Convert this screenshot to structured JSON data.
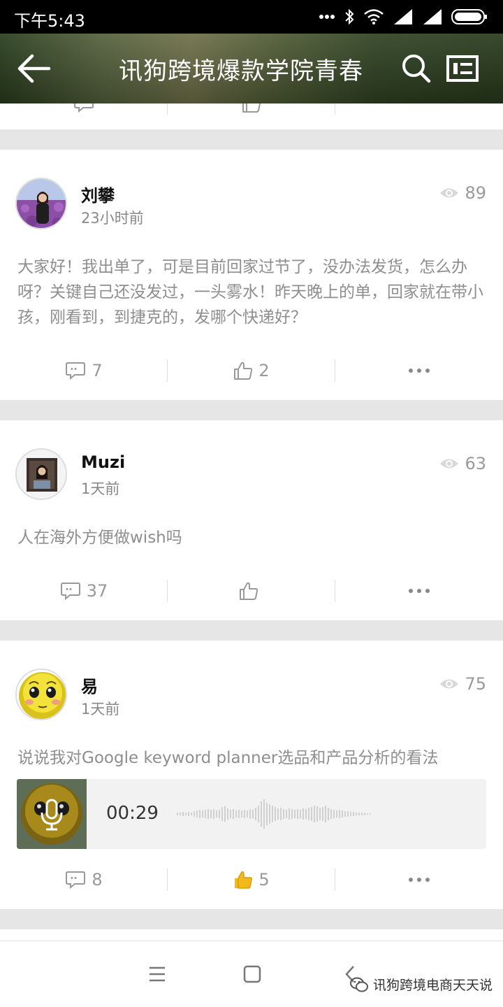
{
  "status_bar": {
    "time": "下午5:43"
  },
  "top_bar": {
    "title": "讯狗跨境爆款学院青春",
    "back_icon": "arrow-left-icon",
    "search_icon": "search-icon",
    "profile_icon": "profile-card-icon"
  },
  "posts": [
    {
      "author": "刘攀",
      "time": "23小时前",
      "views": "89",
      "text": "大家好！我出单了，可是目前回家过节了，没办法发货，怎么办呀？关键自己还没发过，一头雾水！昨天晚上的单，回家就在带小孩，刚看到，到捷克的，发哪个快递好？",
      "comments": "7",
      "likes": "2",
      "liked": false
    },
    {
      "author": "Muzi",
      "time": "1天前",
      "views": "63",
      "text": "人在海外方便做wish吗",
      "comments": "37",
      "likes": "",
      "liked": false
    },
    {
      "author": "易",
      "time": "1天前",
      "views": "75",
      "text": "说说我对Google keyword planner选品和产品分析的看法",
      "audio_duration": "00:29",
      "comments": "8",
      "likes": "5",
      "liked": true
    }
  ],
  "colors": {
    "accent_like": "#f2b91c",
    "muted_text": "#999999"
  },
  "watermark": {
    "text": "讯狗跨境电商天天说"
  }
}
